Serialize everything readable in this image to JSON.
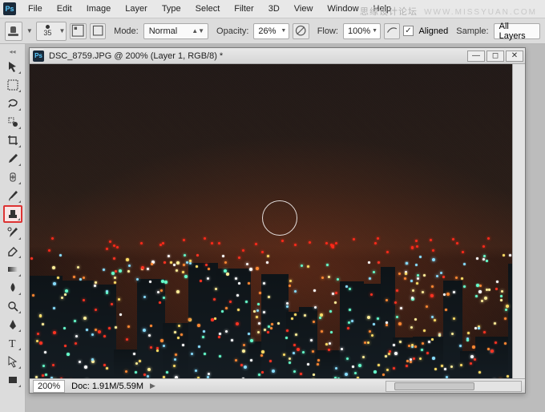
{
  "watermark": {
    "cn": "思缘设计论坛",
    "url": "WWW.MISSYUAN.COM"
  },
  "menu": {
    "items": [
      "File",
      "Edit",
      "Image",
      "Layer",
      "Type",
      "Select",
      "Filter",
      "3D",
      "View",
      "Window",
      "Help"
    ]
  },
  "options": {
    "brush_size": "35",
    "mode_label": "Mode:",
    "mode_value": "Normal",
    "opacity_label": "Opacity:",
    "opacity_value": "26%",
    "flow_label": "Flow:",
    "flow_value": "100%",
    "aligned_label": "Aligned",
    "aligned_checked": true,
    "sample_label": "Sample:",
    "sample_value": "All Layers"
  },
  "tools": [
    {
      "name": "move-tool"
    },
    {
      "name": "marquee-tool"
    },
    {
      "name": "lasso-tool"
    },
    {
      "name": "quick-select-tool"
    },
    {
      "name": "crop-tool"
    },
    {
      "name": "eyedropper-tool"
    },
    {
      "name": "healing-brush-tool"
    },
    {
      "name": "brush-tool"
    },
    {
      "name": "clone-stamp-tool",
      "selected": true
    },
    {
      "name": "history-brush-tool"
    },
    {
      "name": "eraser-tool"
    },
    {
      "name": "gradient-tool"
    },
    {
      "name": "blur-tool"
    },
    {
      "name": "dodge-tool"
    },
    {
      "name": "pen-tool"
    },
    {
      "name": "type-tool"
    },
    {
      "name": "path-select-tool"
    },
    {
      "name": "rectangle-tool"
    }
  ],
  "document": {
    "title": "DSC_8759.JPG @ 200% (Layer 1, RGB/8) *",
    "zoom": "200%",
    "status": "Doc: 1.91M/5.59M"
  }
}
